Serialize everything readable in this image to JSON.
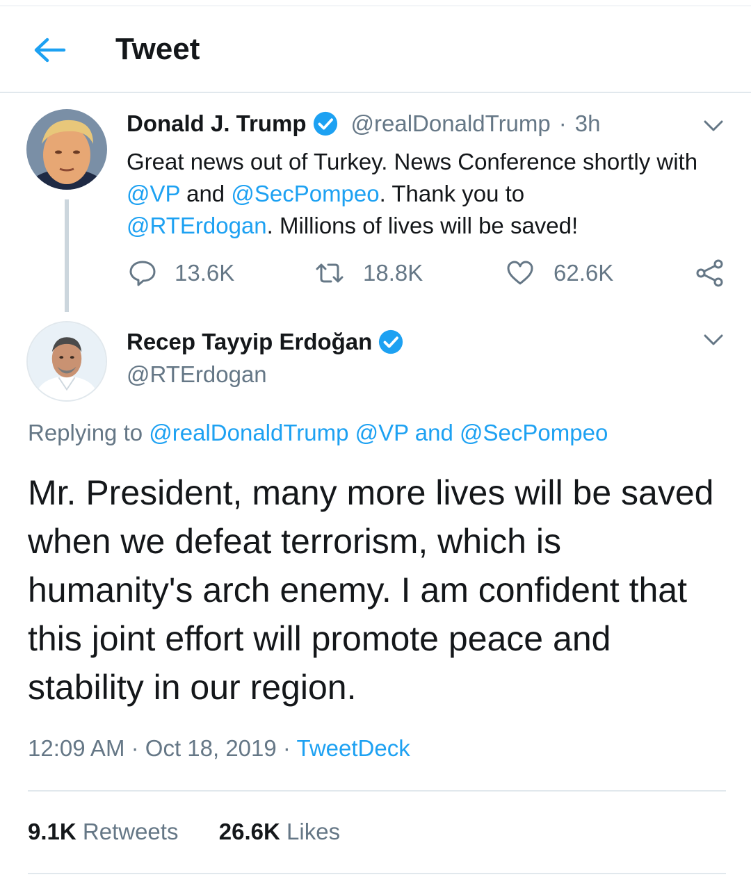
{
  "header": {
    "title": "Tweet",
    "back_icon": "back-arrow-icon"
  },
  "colors": {
    "accent": "#1da1f2",
    "secondary_text": "#657786",
    "primary_text": "#14171a",
    "divider": "#e1e8ed"
  },
  "parent_tweet": {
    "name": "Donald J. Trump",
    "handle": "@realDonaldTrump",
    "separator": "·",
    "time": "3h",
    "text": {
      "t1": "Great news out of Turkey. News Conference shortly with ",
      "m1": "@VP",
      "t2": " and ",
      "m2": "@SecPompeo",
      "t3": ". Thank you to ",
      "m3": "@RTErdogan",
      "t4": ". Millions of lives will be saved!"
    },
    "replies": "13.6K",
    "retweets": "18.8K",
    "likes": "62.6K"
  },
  "main_tweet": {
    "name": "Recep Tayyip Erdoğan",
    "handle": "@RTErdogan",
    "replying_prefix": "Replying to ",
    "replying_m1": "@realDonaldTrump",
    "replying_m2": "@VP",
    "replying_and": "and",
    "replying_m3": "@SecPompeo",
    "text": "Mr. President, many more lives will be saved when we defeat terrorism, which is humanity's arch enemy. I am confident that this joint effort will promote peace and stability in our region.",
    "time": "12:09 AM",
    "separator": "·",
    "date": "Oct 18, 2019",
    "source": "TweetDeck",
    "retweets_count": "9.1K",
    "retweets_label": "Retweets",
    "likes_count": "26.6K",
    "likes_label": "Likes"
  }
}
